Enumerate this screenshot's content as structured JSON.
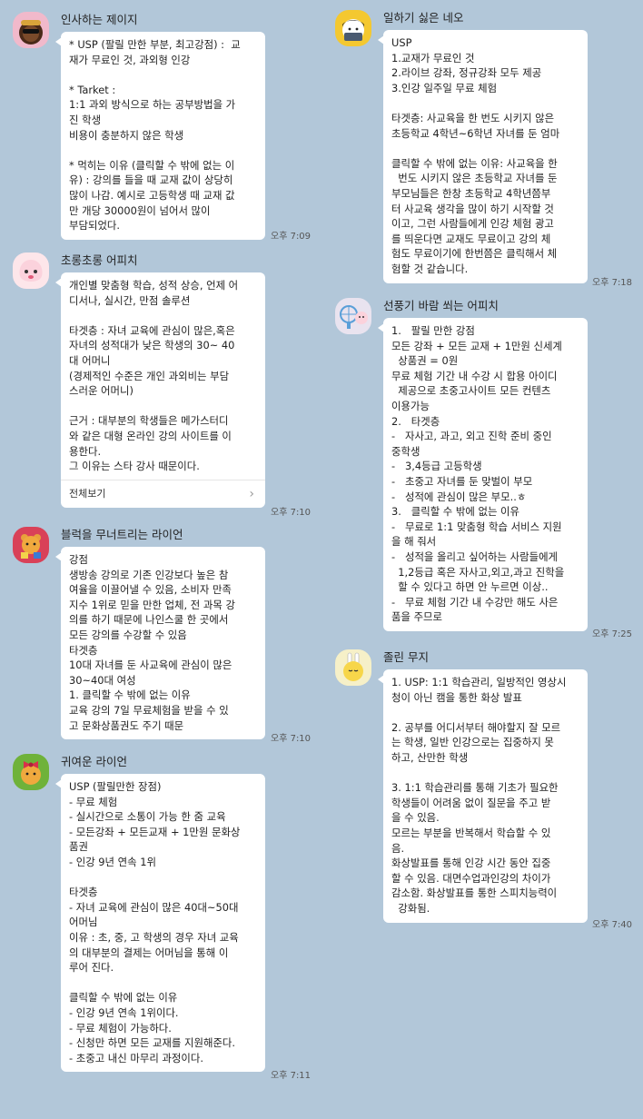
{
  "messages": [
    {
      "sender": "인사하는 제이지",
      "time": "오후 7:09",
      "avatar": "jayg-icon",
      "lines": [
        "* USP (팔릴 만한 부분, 최고강점) :  교",
        "재가 무료인 것, 과외형 인강",
        "",
        "* Tarket :",
        "1:1 과외 방식으로 하는 공부방법을 가",
        "진 학생",
        "비용이 충분하지 않은 학생",
        "",
        "* 먹히는 이유 (클릭할 수 밖에 없는 이",
        "유) : 강의를 들을 때 교재 값이 상당히",
        "많이 나감. 예시로 고등학생 때 교재 값",
        "만 개당 30000원이 넘어서 많이",
        "부담되었다."
      ]
    },
    {
      "sender": "초롱초롱 어피치",
      "time": "오후 7:10",
      "avatar": "apeach-icon",
      "lines": [
        "개인별 맞춤형 학습, 성적 상승, 언제 어",
        "디서나, 실시간, 만점 솔루션",
        "",
        "타겟층 : 자녀 교육에 관심이 많은,혹은",
        "자녀의 성적대가 낮은 학생의 30~ 40",
        "대 어머니",
        "(경제적인 수준은 개인 과외비는 부담",
        "스러운 어머니)",
        "",
        "근거 : 대부분의 학생들은 메가스터디",
        "와 같은 대형 온라인 강의 사이트를 이",
        "용한다.",
        "그 이유는 스타 강사 때문이다."
      ],
      "see_all": "전체보기"
    },
    {
      "sender": "블럭을 무너트리는 라이언",
      "time": "오후 7:10",
      "avatar": "ryan-blocks-icon",
      "lines": [
        "강점",
        "생방송 강의로 기존 인강보다 높은 참",
        "여율을 이끌어낼 수 있음, 소비자 만족",
        "지수 1위로 믿을 만한 업체, 전 과목 강",
        "의를 하기 때문에 나인스쿨 한 곳에서",
        "모든 강의를 수강할 수 있음",
        "타겟층",
        "10대 자녀를 둔 사교육에 관심이 많은",
        "30~40대 여성",
        "1. 클릭할 수 밖에 없는 이유",
        "교육 강의 7일 무료체험을 받을 수 있",
        "고 문화상품권도 주기 때문"
      ]
    },
    {
      "sender": "귀여운 라이언",
      "time": "오후 7:11",
      "avatar": "ryan-ribbon-icon",
      "lines": [
        "USP (팔릴만한 장점)",
        "- 무료 체험",
        "- 실시간으로 소통이 가능 한 줌 교육",
        "- 모든강좌 + 모든교재 + 1만원 문화상",
        "품권",
        "- 인강 9년 연속 1위",
        "",
        "타겟층",
        "- 자녀 교육에 관심이 많은 40대~50대",
        "어머님",
        "이유 : 초, 중, 고 학생의 경우 자녀 교육",
        "의 대부분의 결제는 어머님을 통해 이",
        "루어 진다.",
        "",
        "클릭할 수 밖에 없는 이유",
        "- 인강 9년 연속 1위이다.",
        "- 무료 체험이 가능하다.",
        "- 신청만 하면 모든 교재를 지원해준다.",
        "- 초중고 내신 마무리 과정이다."
      ]
    },
    {
      "sender": "일하기 싫은 네오",
      "time": "오후 7:18",
      "avatar": "neo-icon",
      "lines": [
        "USP",
        "1.교재가 무료인 것",
        "2.라이브 강좌, 정규강좌 모두 제공",
        "3.인강 일주일 무료 체험",
        "",
        "타겟층: 사교육을 한 번도 시키지 않은",
        "초등학교 4학년~6학년 자녀를 둔 엄마",
        "",
        "클릭할 수 밖에 없는 이유: 사교육을 한",
        "  번도 시키지 않은 초등학교 자녀를 둔",
        "부모님들은 한창 초등학교 4학년쯤부",
        "터 사교육 생각을 많이 하기 시작할 것",
        "이고, 그런 사람들에게 인강 체험 광고",
        "를 띄운다면 교재도 무료이고 강의 체",
        "험도 무료이기에 한번쯤은 클릭해서 체",
        "험할 것 같습니다."
      ]
    },
    {
      "sender": "선풍기 바람 쐬는 어피치",
      "time": "오후 7:25",
      "avatar": "apeach-fan-icon",
      "lines": [
        "1.   팔릴 만한 강점",
        "모든 강좌 + 모든 교재 + 1만원 신세계",
        "  상품권 = 0원",
        "무료 체험 기간 내 수강 시 합용 아이디",
        "  제공으로 초중고사이트 모든 컨텐츠",
        "이용가능",
        "2.   타겟층",
        "-   자사고, 과고, 외고 진학 준비 중인",
        "중학생",
        "-   3,4등급 고등학생",
        "-   초중고 자녀를 둔 맞벌이 부모",
        "-   성적에 관심이 많은 부모..ㅎ",
        "3.   클릭할 수 밖에 없는 이유",
        "-   무료로 1:1 맞춤형 학습 서비스 지원",
        "을 해 줘서",
        "-   성적을 올리고 싶어하는 사람들에게",
        "  1,2등급 혹은 자사고,외고,과고 진학을",
        "  할 수 있다고 하면 안 누르면 이상..",
        "-   무료 체험 기간 내 수강만 해도 사은",
        "품을 주므로"
      ]
    },
    {
      "sender": "졸린 무지",
      "time": "오후 7:40",
      "avatar": "muzi-icon",
      "lines": [
        "1. USP: 1:1 학습관리, 일방적인 영상시",
        "청이 아닌 캠을 통한 화상 발표",
        "",
        "2. 공부를 어디서부터 해야할지 잘 모르",
        "는 학생, 일반 인강으로는 집중하지 못",
        "하고, 산만한 학생",
        "",
        "3. 1:1 학습관리를 통해 기초가 필요한",
        "학생들이 어려움 없이 질문을 주고 받",
        "을 수 있음.",
        "모르는 부분을 반복해서 학습할 수 있",
        "음.",
        "화상발표를 통해 인강 시간 동안 집중",
        "할 수 있음. 대면수업과인강의 차이가",
        "감소함. 화상발표를 통한 스피치능력이",
        "  강화됨."
      ]
    }
  ],
  "colors": {
    "background": "#b2c7d9",
    "bubble": "#ffffff",
    "time": "#555555"
  }
}
